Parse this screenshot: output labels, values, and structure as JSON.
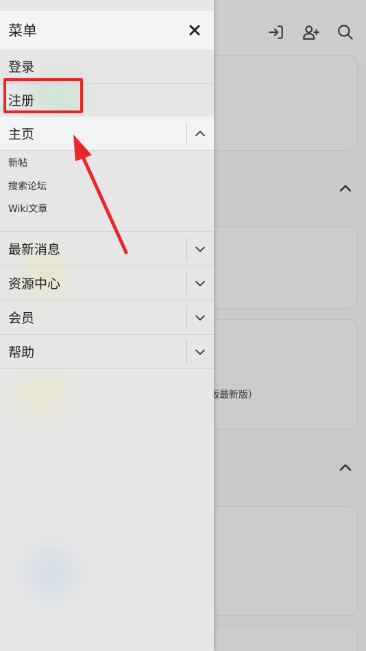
{
  "background": {
    "header_icons": [
      "login-icon",
      "add-user-icon",
      "search-icon"
    ],
    "partial_text": "版最新版）"
  },
  "drawer": {
    "title": "菜单",
    "close_icon": "close-icon",
    "items": [
      {
        "label": "登录"
      },
      {
        "label": "注册"
      },
      {
        "label": "主页",
        "expanded": true,
        "subitems": [
          "新帖",
          "搜索论坛",
          "Wiki文章"
        ]
      },
      {
        "label": "最新消息",
        "expanded": false
      },
      {
        "label": "资源中心",
        "expanded": false
      },
      {
        "label": "会员",
        "expanded": false
      },
      {
        "label": "帮助",
        "expanded": false
      }
    ]
  },
  "annotation": {
    "highlight_color": "#e8262b",
    "arrow_color": "#e8262b"
  }
}
